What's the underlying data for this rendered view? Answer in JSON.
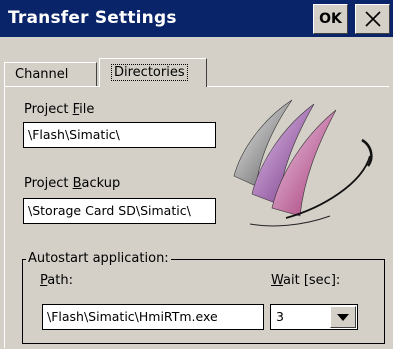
{
  "window": {
    "title": "Transfer Settings",
    "ok_label": "OK",
    "close_glyph": "✕"
  },
  "tabs": [
    {
      "label": "Channel",
      "active": false
    },
    {
      "label": "Directories",
      "active": true
    }
  ],
  "project_file": {
    "label_pre": "Project ",
    "label_key": "F",
    "label_post": "ile",
    "value": "\\Flash\\Simatic\\"
  },
  "project_backup": {
    "label_pre": "Project ",
    "label_key": "B",
    "label_post": "ackup",
    "value": "\\Storage Card SD\\Simatic\\"
  },
  "autostart": {
    "group_title": "Autostart application:",
    "path_label_key": "P",
    "path_label_post": "ath:",
    "path_value": "\\Flash\\Simatic\\HmiRTm.exe",
    "wait_label_key": "W",
    "wait_label_post": "ait [sec]:",
    "wait_value": "3"
  },
  "colors": {
    "titlebar": "#0a246a",
    "face": "#d4d0c8"
  }
}
